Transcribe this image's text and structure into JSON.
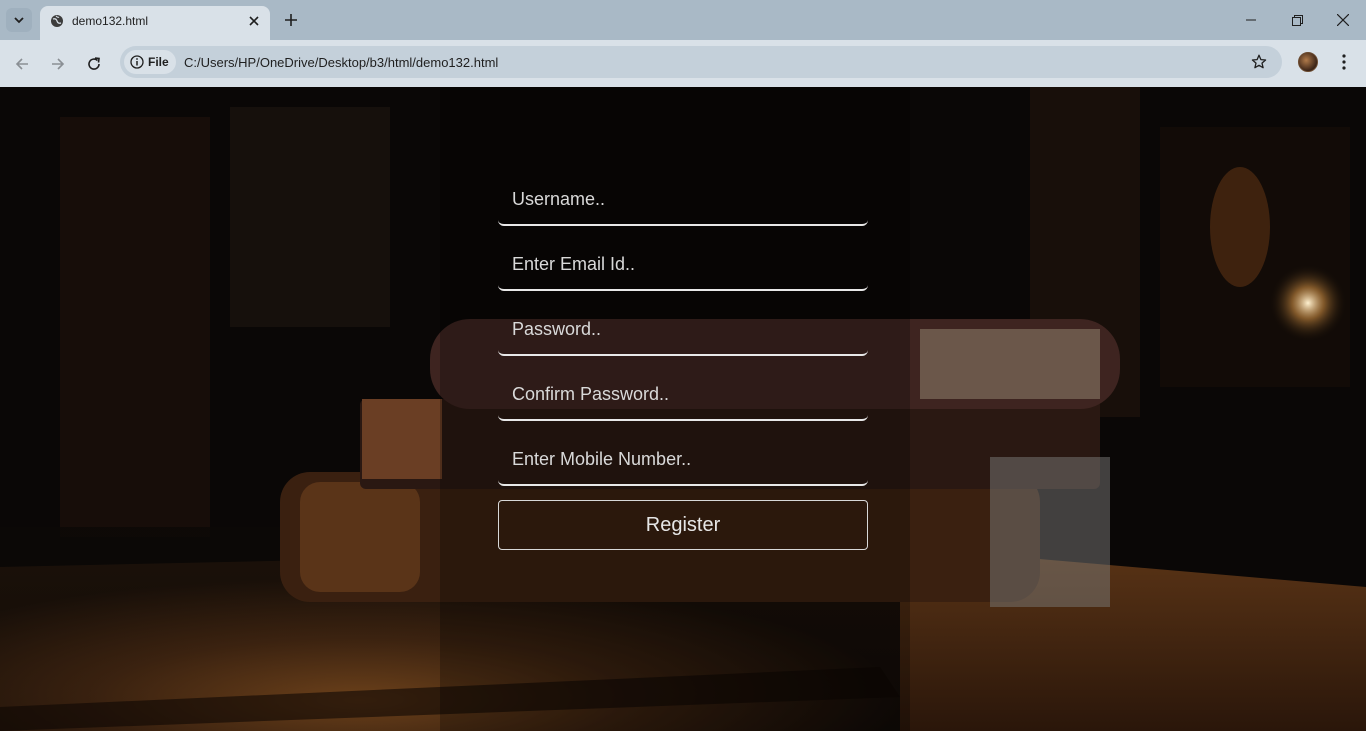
{
  "browser": {
    "tab_title": "demo132.html",
    "site_chip_label": "File",
    "url": "C:/Users/HP/OneDrive/Desktop/b3/html/demo132.html",
    "icons": {
      "tab_list": "chevron-down-icon",
      "favicon": "globe-icon",
      "tab_close": "close-icon",
      "new_tab": "plus-icon",
      "minimize": "minimize-icon",
      "restore": "restore-icon",
      "close_window": "close-icon",
      "back": "back-arrow-icon",
      "forward": "forward-arrow-icon",
      "reload": "reload-icon",
      "info": "info-icon",
      "bookmark": "star-icon",
      "profile": "avatar",
      "menu": "kebab-menu-icon"
    }
  },
  "form": {
    "username_placeholder": "Username..",
    "email_placeholder": "Enter Email Id..",
    "password_placeholder": "Password..",
    "confirm_password_placeholder": "Confirm Password..",
    "mobile_placeholder": "Enter Mobile Number..",
    "register_label": "Register"
  },
  "colors": {
    "chrome_titlebar": "#a9b9c6",
    "chrome_toolbar": "#d9e1e8",
    "field_border": "#e8e8e8",
    "field_text": "#d9d9d9"
  }
}
